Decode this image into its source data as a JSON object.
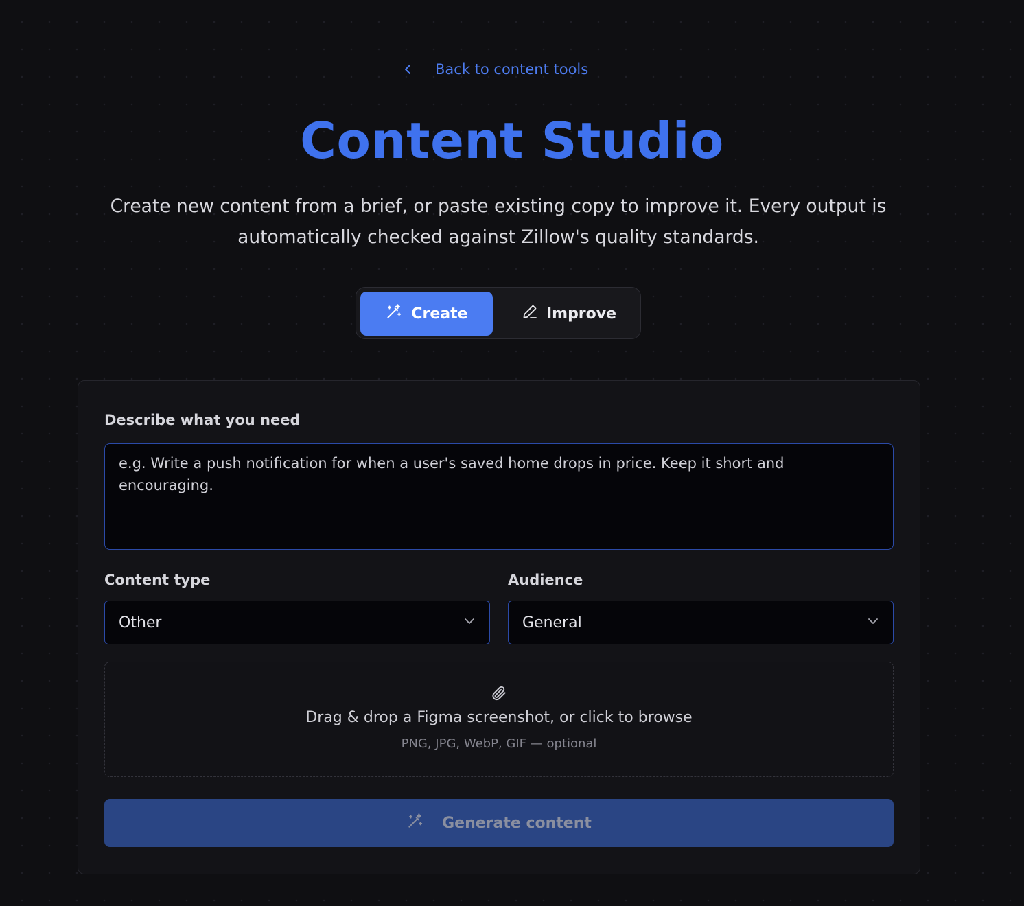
{
  "nav": {
    "back_label": "Back to content tools",
    "back_icon": "chevron-left-icon"
  },
  "header": {
    "title": "Content Studio",
    "subtitle": "Create new content from a brief, or paste existing copy to improve it. Every output is automatically checked against Zillow's quality standards."
  },
  "modes": {
    "create_label": "Create",
    "create_icon": "magic-wand-icon",
    "improve_label": "Improve",
    "improve_icon": "pencil-icon",
    "selected": "Create"
  },
  "form": {
    "brief_label": "Describe what you need",
    "brief_placeholder": "e.g. Write a push notification for when a user's saved home drops in price. Keep it short and encouraging.",
    "brief_value": "",
    "content_type_label": "Content type",
    "content_type_value": "Other",
    "audience_label": "Audience",
    "audience_value": "General",
    "dropzone_text": "Drag & drop a Figma screenshot, or click to browse",
    "dropzone_hint": "PNG, JPG, WebP, GIF — optional",
    "dropzone_icon": "paperclip-icon",
    "generate_label": "Generate content",
    "generate_icon": "magic-wand-icon",
    "generate_disabled": true
  },
  "colors": {
    "accent": "#4b7cf2",
    "title": "#3f72ee",
    "link": "#4d7cf0",
    "background": "#0f0f12",
    "card": "#131317",
    "input_border": "#2b4aa8",
    "generate_disabled": "#2a4584"
  }
}
